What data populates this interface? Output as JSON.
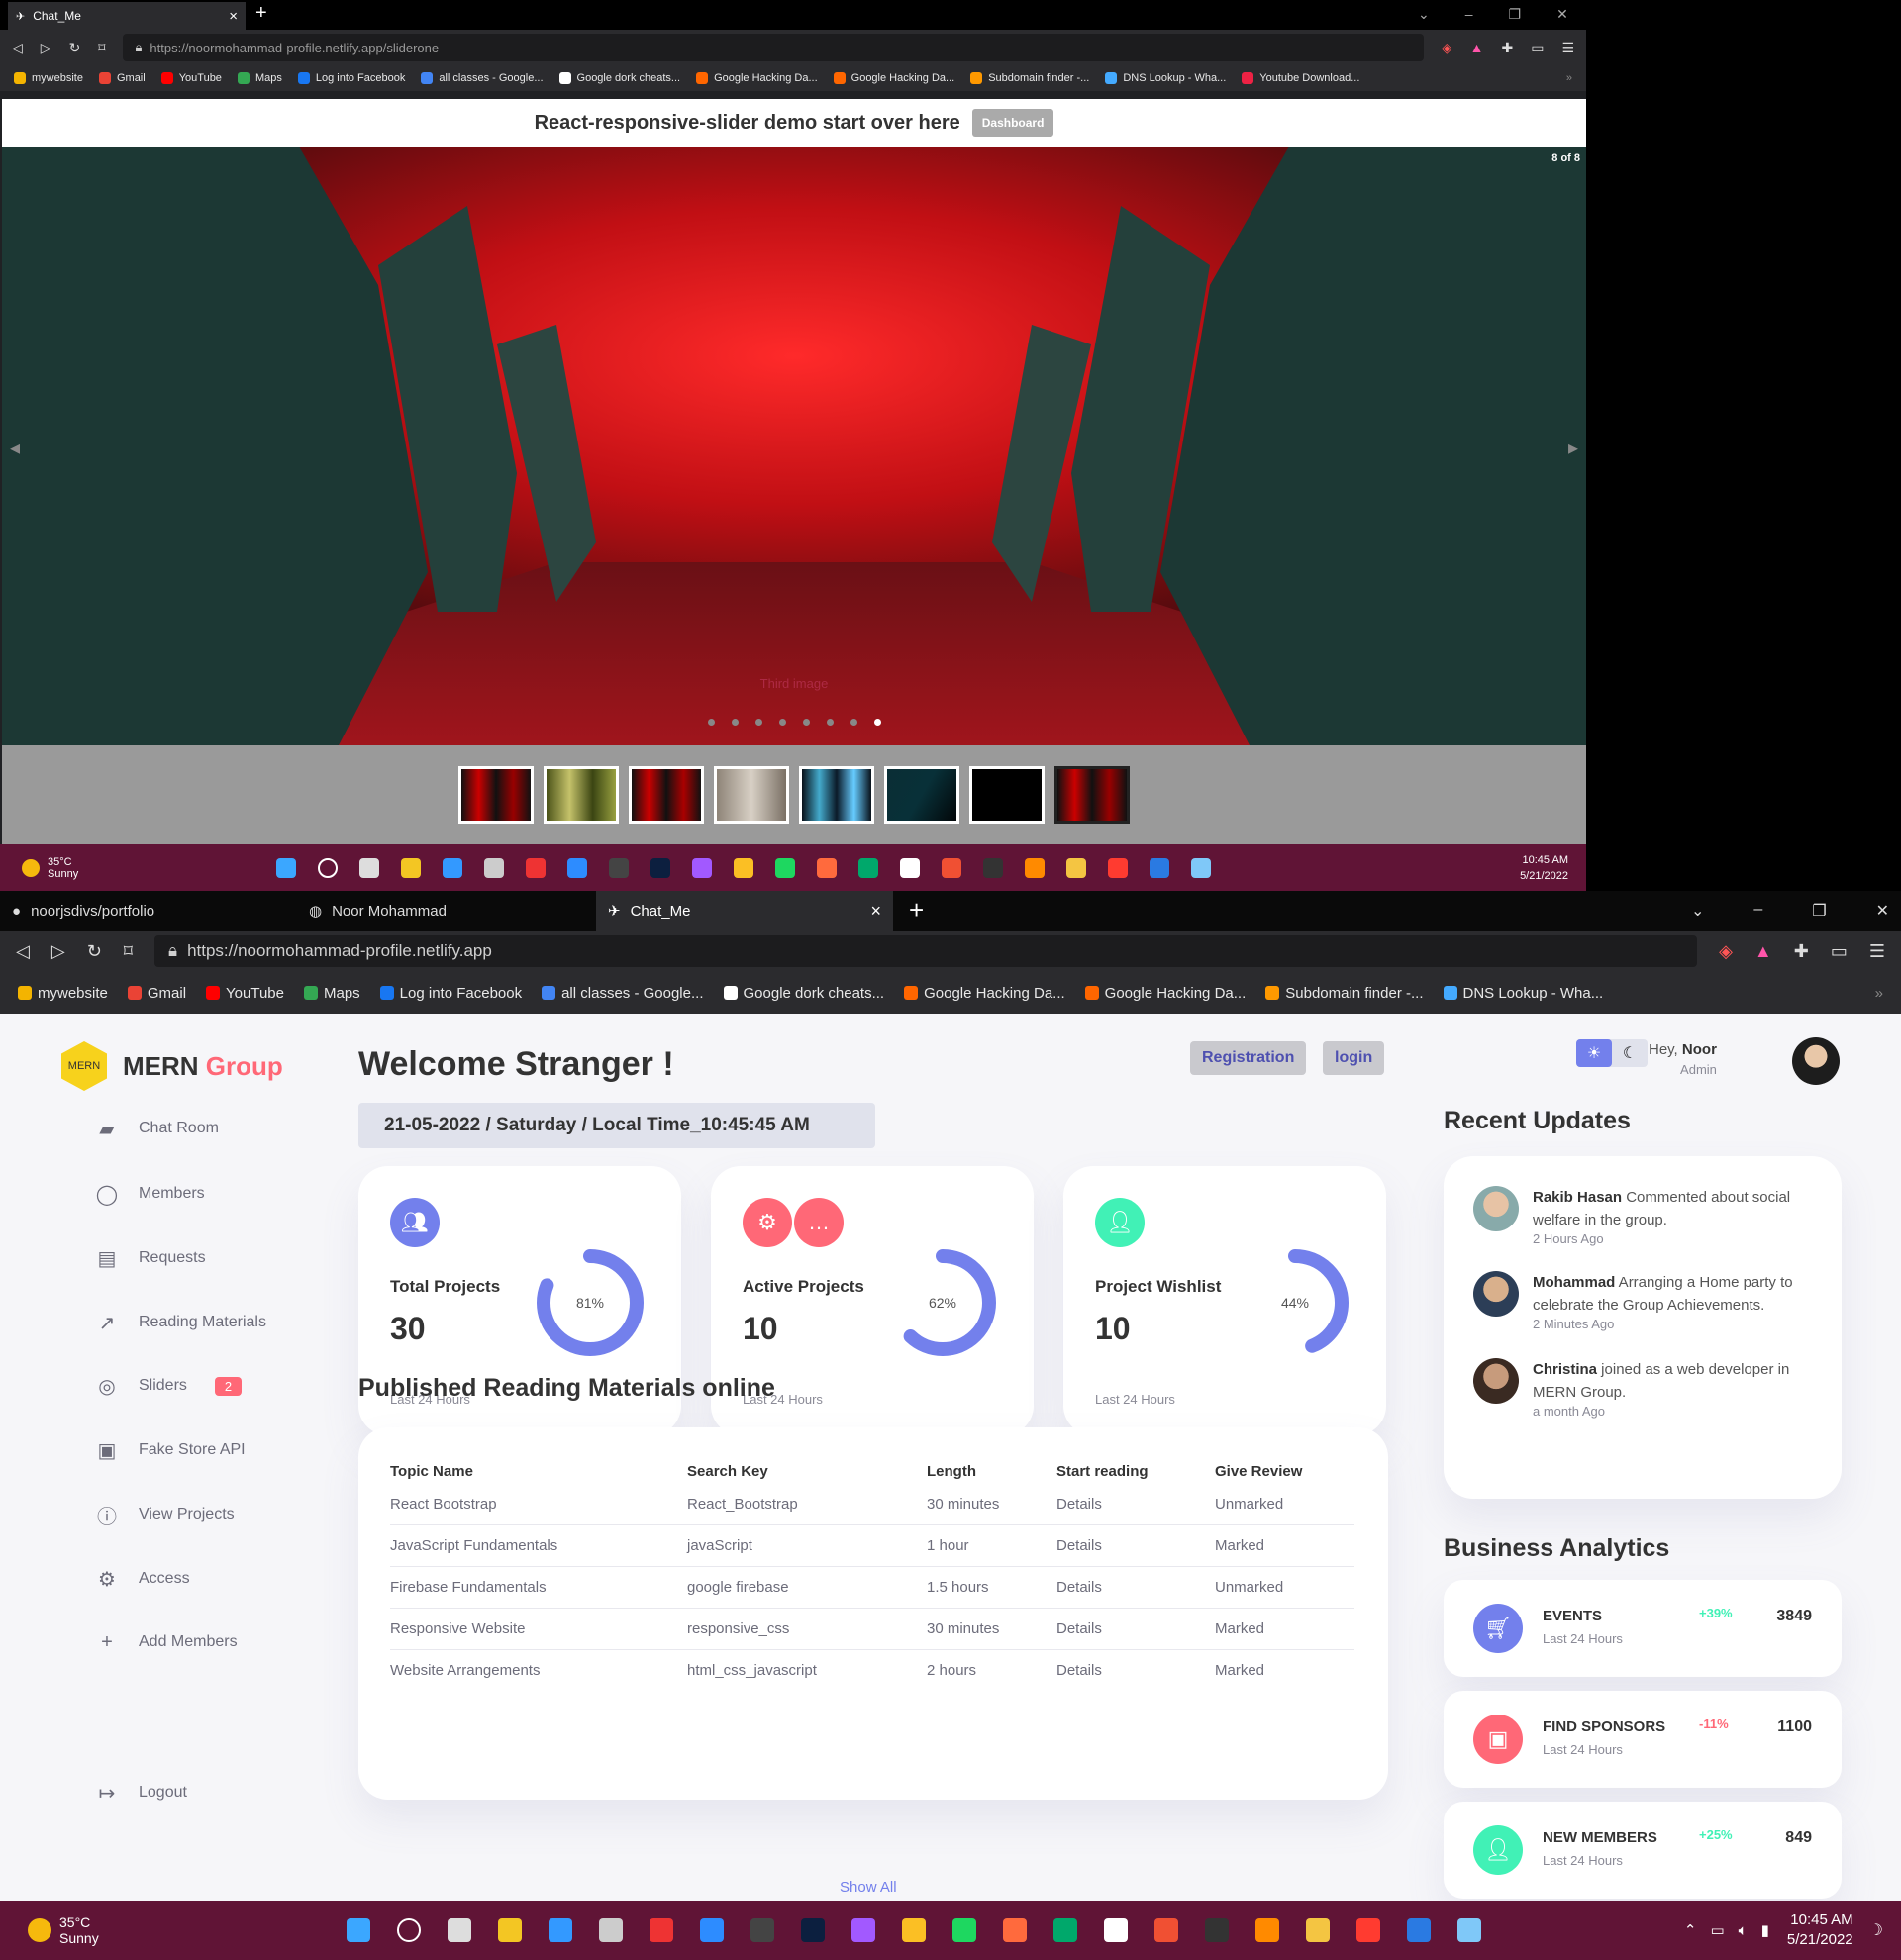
{
  "top_browser": {
    "tab_title": "Chat_Me",
    "url_host": "https://noormohammad-profile.netlify.app",
    "url_path": "/sliderone",
    "bookmarks": [
      "mywebsite",
      "Gmail",
      "YouTube",
      "Maps",
      "Log into Facebook",
      "all classes - Google...",
      "Google dork cheats...",
      "Google Hacking Da...",
      "Google Hacking Da...",
      "Subdomain finder -...",
      "DNS Lookup - Wha...",
      "Youtube Download..."
    ],
    "more": "»"
  },
  "slider": {
    "heading": "React-responsive-slider demo start over here",
    "dashboard_label": "Dashboard",
    "counter": "8 of 8",
    "caption": "Third image",
    "prev": "◂",
    "next": "▸"
  },
  "taskbar_top": {
    "temp": "35°C",
    "weather": "Sunny",
    "time": "10:45 AM",
    "date": "5/21/2022"
  },
  "bottom_browser": {
    "tabs": [
      "noorjsdivs/portfolio",
      "Noor Mohammad",
      "Chat_Me"
    ],
    "url": "https://noormohammad-profile.netlify.app",
    "bookmarks": [
      "mywebsite",
      "Gmail",
      "YouTube",
      "Maps",
      "Log into Facebook",
      "all classes - Google...",
      "Google dork cheats...",
      "Google Hacking Da...",
      "Google Hacking Da...",
      "Subdomain finder -...",
      "DNS Lookup - Wha..."
    ],
    "more": "»"
  },
  "dashboard": {
    "logo_badge": "MERN",
    "logo_a": "MERN",
    "logo_b": "Group",
    "sidebar": [
      {
        "label": "Chat Room",
        "icon": "chat-icon"
      },
      {
        "label": "Members",
        "icon": "person-icon"
      },
      {
        "label": "Requests",
        "icon": "receipt-icon"
      },
      {
        "label": "Reading Materials",
        "icon": "insights-icon"
      },
      {
        "label": "Sliders",
        "icon": "slider-icon",
        "badge": "2"
      },
      {
        "label": "Fake Store API",
        "icon": "inventory-icon"
      },
      {
        "label": "View Projects",
        "icon": "report-icon"
      },
      {
        "label": "Access",
        "icon": "settings-icon"
      },
      {
        "label": "Add Members",
        "icon": "add-icon"
      },
      {
        "label": "Logout",
        "icon": "logout-icon"
      }
    ],
    "welcome": "Welcome Stranger !",
    "registration": "Registration",
    "login": "login",
    "date_line": "21-05-2022 / Saturday / Local Time_10:45:45 AM",
    "cards": [
      {
        "title": "Total Projects",
        "value": "30",
        "percent": 81,
        "percent_label": "81%",
        "sub": "Last 24 Hours"
      },
      {
        "title": "Active Projects",
        "value": "10",
        "percent": 62,
        "percent_label": "62%",
        "sub": "Last 24 Hours"
      },
      {
        "title": "Project Wishlist",
        "value": "10",
        "percent": 44,
        "percent_label": "44%",
        "sub": "Last 24 Hours"
      }
    ],
    "colors": {
      "primary": "#7380ec",
      "danger": "#ff6877",
      "success": "#41f1b6",
      "warning": "#ffbb55"
    },
    "materials_title": "Published Reading Materials online",
    "table_headers": [
      "Topic Name",
      "Search Key",
      "Length",
      "Start reading",
      "Give Review"
    ],
    "table_rows": [
      [
        "React Bootstrap",
        "React_Bootstrap",
        "30 minutes",
        "Details",
        "Unmarked"
      ],
      [
        "JavaScript Fundamentals",
        "javaScript",
        "1 hour",
        "Details",
        "Marked"
      ],
      [
        "Firebase Fundamentals",
        "google firebase",
        "1.5 hours",
        "Details",
        "Unmarked"
      ],
      [
        "Responsive Website",
        "responsive_css",
        "30 minutes",
        "Details",
        "Marked"
      ],
      [
        "Website Arrangements",
        "html_css_javascript",
        "2 hours",
        "Details",
        "Marked"
      ]
    ],
    "show_all": "Show All",
    "hey": "Hey,",
    "user": "Noor",
    "role": "Admin",
    "updates_title": "Recent Updates",
    "updates": [
      {
        "name": "Rakib Hasan",
        "text": " Commented about social welfare in the group.",
        "time": "2 Hours Ago"
      },
      {
        "name": "Mohammad",
        "text": " Arranging a Home party to celebrate the Group Achievements.",
        "time": "2 Minutes Ago"
      },
      {
        "name": "Christina",
        "text": " joined as a web developer in MERN Group.",
        "time": "a month Ago"
      }
    ],
    "analytics_title": "Business Analytics",
    "analytics": [
      {
        "title": "EVENTS",
        "sub": "Last 24 Hours",
        "pct": "+39%",
        "value": "3849"
      },
      {
        "title": "FIND SPONSORS",
        "sub": "Last 24 Hours",
        "pct": "-11%",
        "value": "1100"
      },
      {
        "title": "NEW MEMBERS",
        "sub": "Last 24 Hours",
        "pct": "+25%",
        "value": "849"
      }
    ]
  },
  "taskbar_bottom": {
    "temp": "35°C",
    "weather": "Sunny",
    "time": "10:45 AM",
    "date": "5/21/2022"
  }
}
